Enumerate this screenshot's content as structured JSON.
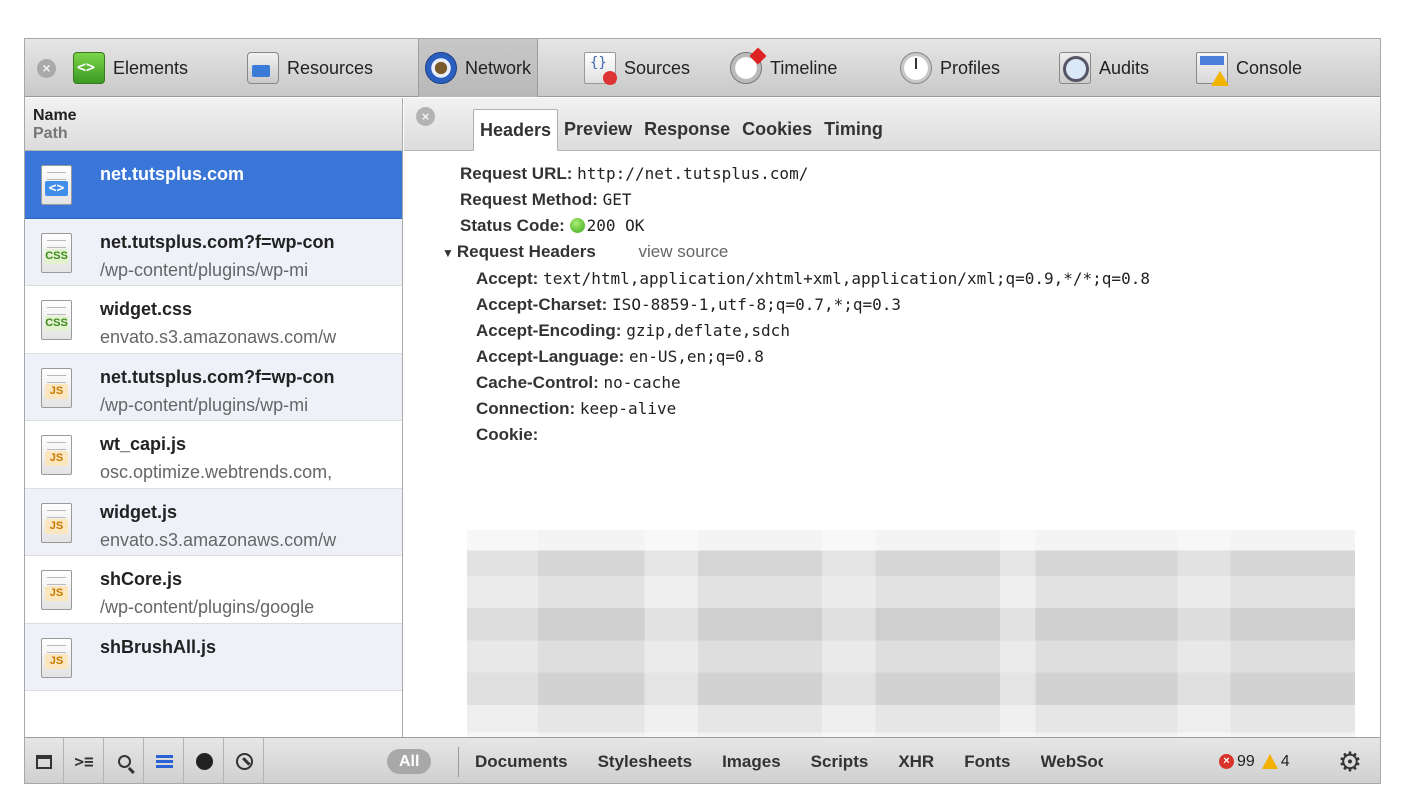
{
  "toolbar": {
    "items": [
      {
        "label": "Elements",
        "icon": "elements-icon"
      },
      {
        "label": "Resources",
        "icon": "resources-icon"
      },
      {
        "label": "Network",
        "icon": "network-icon",
        "active": true
      },
      {
        "label": "Sources",
        "icon": "sources-icon"
      },
      {
        "label": "Timeline",
        "icon": "timeline-icon"
      },
      {
        "label": "Profiles",
        "icon": "profiles-icon"
      },
      {
        "label": "Audits",
        "icon": "audits-icon"
      },
      {
        "label": "Console",
        "icon": "console-icon"
      }
    ]
  },
  "list": {
    "header_name": "Name",
    "header_path": "Path",
    "rows": [
      {
        "name": "net.tutsplus.com",
        "path": "",
        "type": "html",
        "selected": true
      },
      {
        "name": "net.tutsplus.com?f=wp-con",
        "path": "/wp-content/plugins/wp-mi",
        "type": "CSS"
      },
      {
        "name": "widget.css",
        "path": "envato.s3.amazonaws.com/w",
        "type": "CSS"
      },
      {
        "name": "net.tutsplus.com?f=wp-con",
        "path": "/wp-content/plugins/wp-mi",
        "type": "JS"
      },
      {
        "name": "wt_capi.js",
        "path": "osc.optimize.webtrends.com,",
        "type": "JS"
      },
      {
        "name": "widget.js",
        "path": "envato.s3.amazonaws.com/w",
        "type": "JS"
      },
      {
        "name": "shCore.js",
        "path": "/wp-content/plugins/google",
        "type": "JS"
      },
      {
        "name": "shBrushAll.js",
        "path": "",
        "type": "JS"
      }
    ]
  },
  "detail": {
    "tabs": [
      "Headers",
      "Preview",
      "Response",
      "Cookies",
      "Timing"
    ],
    "active_tab": "Headers",
    "general": [
      {
        "key": "Request URL:",
        "value": "http://net.tutsplus.com/"
      },
      {
        "key": "Request Method:",
        "value": "GET"
      },
      {
        "key": "Status Code:",
        "value": "200 OK"
      }
    ],
    "section_title": "Request Headers",
    "view_source": "view source",
    "request_headers": [
      {
        "key": "Accept:",
        "value": "text/html,application/xhtml+xml,application/xml;q=0.9,*/*;q=0.8"
      },
      {
        "key": "Accept-Charset:",
        "value": "ISO-8859-1,utf-8;q=0.7,*;q=0.3"
      },
      {
        "key": "Accept-Encoding:",
        "value": "gzip,deflate,sdch"
      },
      {
        "key": "Accept-Language:",
        "value": "en-US,en;q=0.8"
      },
      {
        "key": "Cache-Control:",
        "value": "no-cache"
      },
      {
        "key": "Connection:",
        "value": "keep-alive"
      },
      {
        "key": "Cookie:",
        "value": ""
      }
    ]
  },
  "statusbar": {
    "all_label": "All",
    "filters": [
      "Documents",
      "Stylesheets",
      "Images",
      "Scripts",
      "XHR",
      "Fonts",
      "WebSoc"
    ],
    "errors": "99",
    "warnings": "4"
  },
  "colors": {
    "selection": "#3a76d7",
    "status_ok": "#3aa51b",
    "error": "#d8342b",
    "warning": "#f2b100"
  }
}
